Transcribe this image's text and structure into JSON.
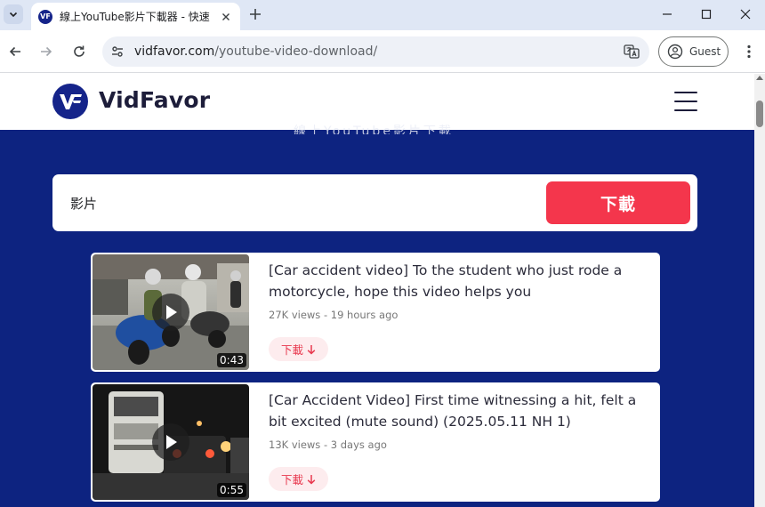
{
  "browser": {
    "tab_title": "線上YouTube影片下載器 - 快速",
    "favicon_text": "VF",
    "url_host": "vidfavor.com",
    "url_path": "/youtube-video-download/",
    "profile_label": "Guest"
  },
  "site": {
    "logo_text": "VidFavor",
    "hero_heading_clipped": "線上YouTube影片下載",
    "search": {
      "value": "影片",
      "placeholder": ""
    },
    "download_button": "下載"
  },
  "results": [
    {
      "title": "[Car accident video] To the student who just rode a motorcycle, hope this video helps you",
      "meta": "27K views - 19 hours ago",
      "duration": "0:43",
      "download_label": "下載"
    },
    {
      "title": "[Car Accident Video] First time witnessing a hit, felt a bit excited (mute sound) (2025.05.11 NH 1)",
      "meta": "13K views - 3 days ago",
      "duration": "0:55",
      "download_label": "下載"
    }
  ],
  "colors": {
    "hero_bg": "#0d2380",
    "accent": "#f4364c",
    "logo": "#15248a"
  }
}
